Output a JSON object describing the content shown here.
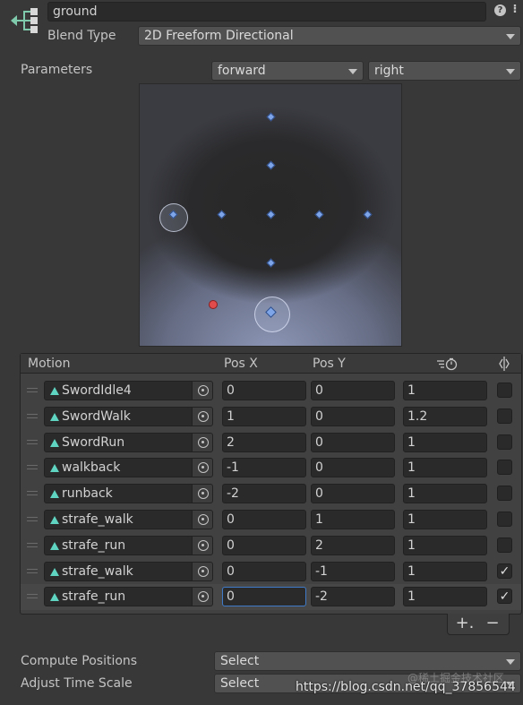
{
  "header": {
    "node_name": "ground",
    "help_icon": "?",
    "settings_icon": "⁝",
    "blend_type_label": "Blend Type",
    "blend_type_value": "2D Freeform Directional"
  },
  "parameters": {
    "label": "Parameters",
    "param_x": "forward",
    "param_y": "right"
  },
  "table": {
    "headers": {
      "motion": "Motion",
      "pos_x": "Pos X",
      "pos_y": "Pos Y",
      "time_scale_icon": "time-scale-icon",
      "mirror_icon": "mirror-icon"
    },
    "rows": [
      {
        "motion": "SwordIdle4",
        "pos_x": "0",
        "pos_y": "0",
        "speed": "1",
        "mirror": false
      },
      {
        "motion": "SwordWalk",
        "pos_x": "1",
        "pos_y": "0",
        "speed": "1.2",
        "mirror": false
      },
      {
        "motion": "SwordRun",
        "pos_x": "2",
        "pos_y": "0",
        "speed": "1",
        "mirror": false
      },
      {
        "motion": "walkback",
        "pos_x": "-1",
        "pos_y": "0",
        "speed": "1",
        "mirror": false
      },
      {
        "motion": "runback",
        "pos_x": "-2",
        "pos_y": "0",
        "speed": "1",
        "mirror": false
      },
      {
        "motion": "strafe_walk",
        "pos_x": "0",
        "pos_y": "1",
        "speed": "1",
        "mirror": false
      },
      {
        "motion": "strafe_run",
        "pos_x": "0",
        "pos_y": "2",
        "speed": "1",
        "mirror": false
      },
      {
        "motion": "strafe_walk",
        "pos_x": "0",
        "pos_y": "-1",
        "speed": "1",
        "mirror": true
      },
      {
        "motion": "strafe_run",
        "pos_x": "0",
        "pos_y": "-2",
        "speed": "1",
        "mirror": true
      }
    ],
    "add_label": "+.",
    "remove_label": "−"
  },
  "footer": {
    "compute_positions_label": "Compute Positions",
    "compute_positions_value": "Select",
    "adjust_time_scale_label": "Adjust Time Scale",
    "adjust_time_scale_value": "Select"
  },
  "watermark": {
    "url": "https://blog.csdn.net/qq_37856544",
    "top": "@稀土掘金技术社区"
  },
  "colors": {
    "accent_focus": "#3e7ac8",
    "sample_point": "#7ea5e8",
    "current_param": "#e04b4b",
    "clip_icon": "#5fd4c0"
  }
}
